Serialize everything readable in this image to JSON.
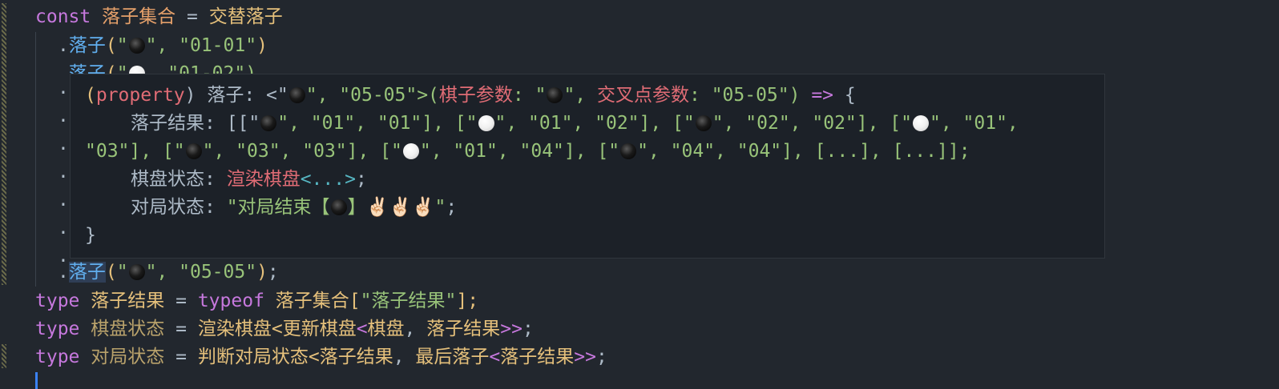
{
  "editor": {
    "line1": {
      "kw": "const",
      "name": "落子集合",
      "op": "=",
      "value": "交替落子"
    },
    "line2": {
      "dot": ".",
      "method": "落子",
      "open": "(",
      "q1": "\"",
      "q2": "\", ",
      "coord": "\"01-01\"",
      "close": ")"
    },
    "line3_partial": {
      "dot": ".",
      "method": "落子",
      "open": "(",
      "q1": "\"",
      "rest": "  \"01-02\")"
    },
    "line_last_call": {
      "dot": ".",
      "method": "落子",
      "open": "(",
      "q1": "\"",
      "q2": "\", ",
      "coord": "\"05-05\"",
      "close": ")",
      "semi": ";"
    },
    "type1": {
      "kw": "type",
      "name": "落子结果",
      "op": "=",
      "typeof": "typeof",
      "obj": "落子集合",
      "lb": "[",
      "key": "\"落子结果\"",
      "rb": "];"
    },
    "type2": {
      "kw": "type",
      "name": "棋盘状态",
      "op": "=",
      "f1": "渲染棋盘",
      "lt1": "<",
      "f2": "更新棋盘",
      "lt2": "<",
      "a1": "棋盘",
      "comma": ", ",
      "a2": "落子结果",
      "gt": ">>",
      "semi": ";"
    },
    "type3": {
      "kw": "type",
      "name": "对局状态",
      "op": "=",
      "f1": "判断对局状态",
      "lt1": "<",
      "a1": "落子结果",
      "comma": ", ",
      "f2": "最后落子",
      "lt2": "<",
      "a2": "落子结果",
      "gt": ">>",
      "semi": ";"
    },
    "dot": "."
  },
  "hover": {
    "l1": {
      "open": "(",
      "property": "property",
      "close": ") 落子: <\"",
      "mid": "\", \"05-05\">(",
      "p1": "棋子参数",
      "colon1": ": \"",
      "mid2": "\", ",
      "p2": "交叉点参数",
      "colon2": ": \"05-05\")",
      "arrow": " =>",
      "brace": " {"
    },
    "l2": {
      "label": "落子结果: [[\"",
      "a": "\", \"01\", \"01\"], [\"",
      "b": "\", \"01\", \"02\"], [\"",
      "c": "\", \"02\", \"02\"], [\"",
      "d": "\", \"01\","
    },
    "l3": {
      "a": "\"03\"], [\"",
      "b": "\", \"03\", \"03\"], [\"",
      "c": "\", \"01\", \"04\"], [\"",
      "d": "\", \"04\", \"04\"], [...], [...]];"
    },
    "l4": {
      "label": "棋盘状态: ",
      "type": "渲染棋盘",
      "gen": "<...>",
      "semi": ";"
    },
    "l5": {
      "label": "对局状态: ",
      "str": "\"对局结束【",
      "str2": "】",
      "hands": "✌🏻✌🏻✌🏻",
      "endq": "\"",
      "semi": ";"
    },
    "l6": {
      "brace": "}"
    }
  }
}
